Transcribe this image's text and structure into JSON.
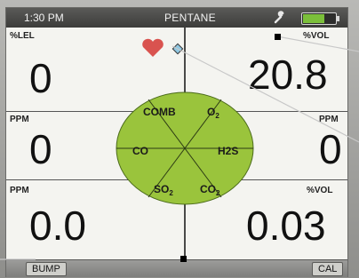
{
  "status_bar": {
    "time": "1:30 PM",
    "gas_name": "PENTANE",
    "wrench_icon": "wrench-icon",
    "battery_icon": "battery-icon",
    "battery_level": 0.7,
    "battery_color": "#7bbf3a"
  },
  "readings": {
    "top_left": {
      "unit": "%LEL",
      "value": "0"
    },
    "top_right": {
      "unit": "%VOL",
      "value": "20.8"
    },
    "mid_left": {
      "unit": "PPM",
      "value": "0"
    },
    "mid_right": {
      "unit": "PPM",
      "value": "0"
    },
    "bottom_left": {
      "unit": "PPM",
      "value": "0.0"
    },
    "bottom_right": {
      "unit": "%VOL",
      "value": "0.03"
    }
  },
  "gas_wheel": {
    "color": "#9ac43c",
    "sensors": [
      "COMB",
      "O2",
      "H2S",
      "CO2",
      "SO2",
      "CO"
    ]
  },
  "indicators": {
    "heart_icon": "heart-icon",
    "heart_color": "#d9534f",
    "peak_icon": "diamond-icon"
  },
  "softkeys": {
    "left": "BUMP",
    "right": "CAL"
  }
}
